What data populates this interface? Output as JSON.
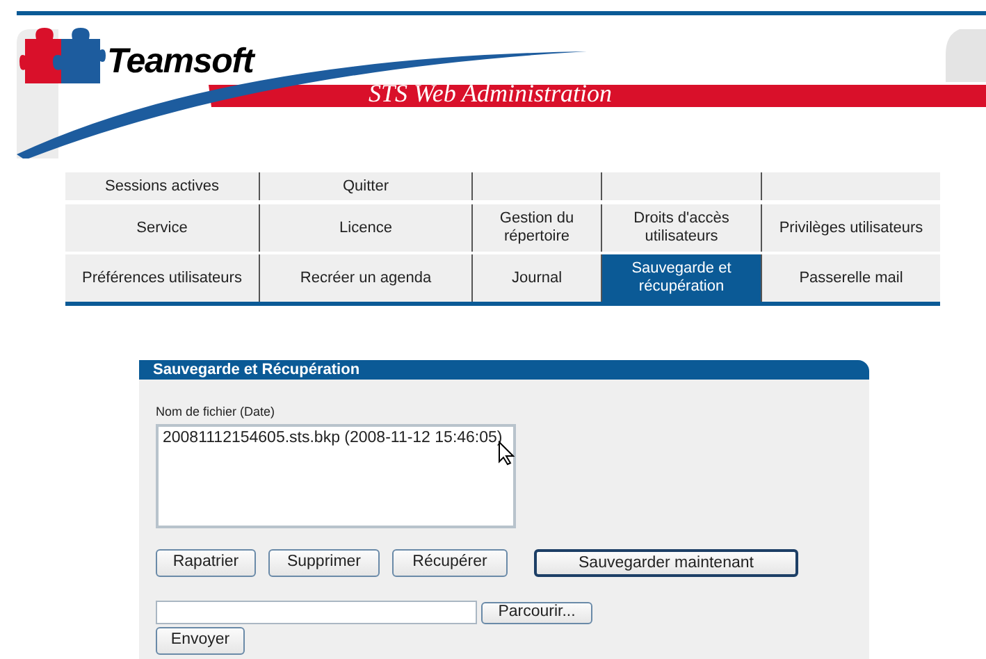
{
  "header": {
    "brand": "Teamsoft",
    "subtitle": "STS Web Administration"
  },
  "menu": {
    "rows": [
      [
        {
          "label": "Sessions actives",
          "selected": false
        },
        {
          "label": "Quitter",
          "selected": false
        },
        {
          "selected": false
        },
        {
          "selected": false
        },
        {
          "selected": false
        }
      ],
      [
        {
          "label": "Service",
          "selected": false
        },
        {
          "label": "Licence",
          "selected": false
        },
        {
          "label": "Gestion du répertoire",
          "selected": false
        },
        {
          "label": "Droits d'accès utilisateurs",
          "selected": false
        },
        {
          "label": "Privilèges utilisateurs",
          "selected": false
        }
      ],
      [
        {
          "label": "Préférences utilisateurs",
          "selected": false
        },
        {
          "label": "Recréer un agenda",
          "selected": false
        },
        {
          "label": "Journal",
          "selected": false
        },
        {
          "label": "Sauvegarde et récupération",
          "selected": true
        },
        {
          "label": "Passerelle mail",
          "selected": false
        }
      ]
    ]
  },
  "panel": {
    "title": "Sauvegarde et Récupération",
    "list_label": "Nom de fichier (Date)",
    "files": [
      {
        "label": "20081112154605.sts.bkp (2008-11-12 15:46:05)",
        "selected": false
      }
    ],
    "buttons": [
      {
        "label": "Rapatrier",
        "focused": false
      },
      {
        "label": "Supprimer",
        "focused": false
      },
      {
        "label": "Récupérer",
        "focused": false
      },
      {
        "label": "Sauvegarder maintenant",
        "focused": true
      }
    ],
    "browse_button": "Parcourir...",
    "send_button": "Envoyer"
  }
}
